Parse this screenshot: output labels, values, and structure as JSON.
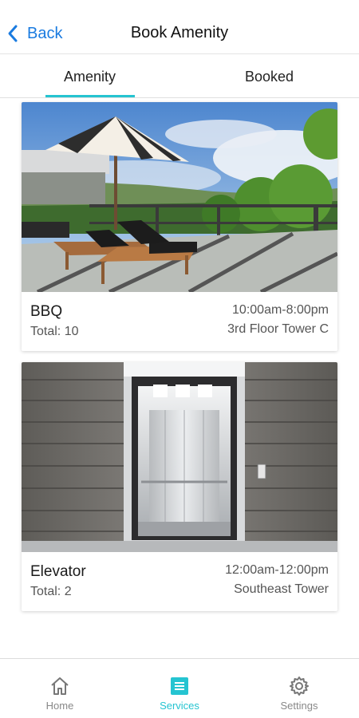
{
  "header": {
    "back_label": "Back",
    "title": "Book Amenity",
    "back_icon": "chevron-left-icon"
  },
  "tabs": [
    {
      "label": "Amenity",
      "active": true
    },
    {
      "label": "Booked",
      "active": false
    }
  ],
  "amenities": [
    {
      "name": "BBQ",
      "total": "Total: 10",
      "hours": "10:00am-8:00pm",
      "location": "3rd Floor Tower C",
      "image": "rooftop-terrace-photo"
    },
    {
      "name": "Elevator",
      "total": "Total: 2",
      "hours": "12:00am-12:00pm",
      "location": "Southeast Tower",
      "image": "elevator-photo"
    }
  ],
  "tabbar": {
    "items": [
      {
        "label": "Home",
        "icon": "home-icon",
        "active": false
      },
      {
        "label": "Services",
        "icon": "services-icon",
        "active": true
      },
      {
        "label": "Settings",
        "icon": "gear-icon",
        "active": false
      }
    ]
  },
  "colors": {
    "accent": "#25c4d1",
    "link": "#1a7be0",
    "inactive": "#888888"
  }
}
